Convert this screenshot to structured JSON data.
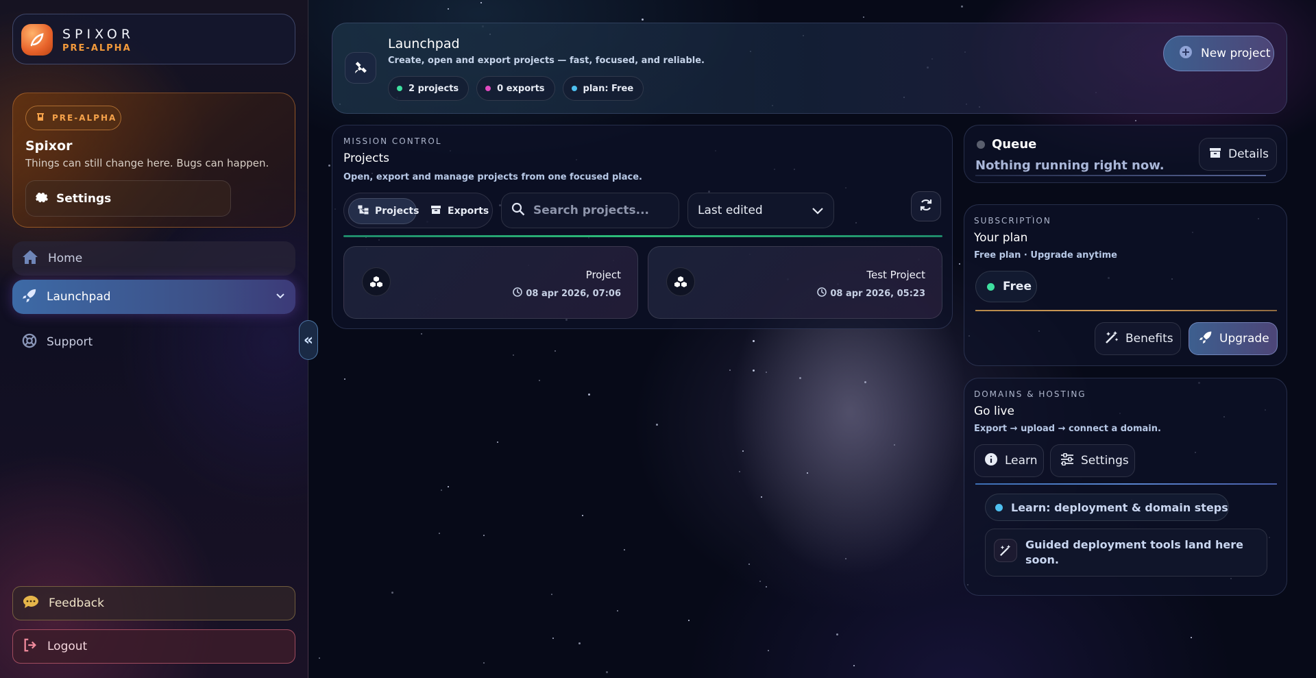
{
  "brand": {
    "name": "SPIXOR",
    "stage": "PRE-ALPHA"
  },
  "notice": {
    "badge": "PRE-ALPHA",
    "title": "Spixor",
    "description": "Things can still change here. Bugs can happen.",
    "settings_label": "Settings"
  },
  "nav": {
    "home": "Home",
    "launchpad": "Launchpad",
    "support": "Support",
    "feedback": "Feedback",
    "logout": "Logout"
  },
  "hero": {
    "title": "Launchpad",
    "description": "Create, open and export projects — fast, focused, and reliable.",
    "pills": [
      {
        "label": "2 projects",
        "color": "#3ee0a0"
      },
      {
        "label": "0 exports",
        "color": "#e04ac0"
      },
      {
        "label": "plan: Free",
        "color": "#4ec0f0"
      }
    ],
    "new_project_label": "New project"
  },
  "mission": {
    "eyebrow": "MISSION CONTROL",
    "title": "Projects",
    "description": "Open, export and manage projects from one focused place.",
    "tabs": {
      "projects": "Projects",
      "exports": "Exports"
    },
    "search_placeholder": "Search projects...",
    "sort_value": "Last edited",
    "projects": [
      {
        "name": "Project",
        "date": "08 apr 2026, 07:06"
      },
      {
        "name": "Test Project",
        "date": "08 apr 2026, 05:23"
      }
    ]
  },
  "queue": {
    "title": "Queue",
    "status": "Nothing running right now.",
    "details_label": "Details"
  },
  "subscription": {
    "eyebrow": "SUBSCRIPTION",
    "title": "Your plan",
    "description": "Free plan · Upgrade anytime",
    "plan": "Free",
    "benefits_label": "Benefits",
    "upgrade_label": "Upgrade"
  },
  "domains": {
    "eyebrow": "DOMAINS & HOSTING",
    "title": "Go live",
    "description": "Export → upload → connect a domain.",
    "learn_label": "Learn",
    "settings_label": "Settings",
    "learn_pill": "Learn: deployment & domain steps",
    "guided": "Guided deployment tools land here soon."
  },
  "colors": {
    "accent": "#3d6aa6",
    "brand_orange": "#f39a3b",
    "success": "#2ec07a"
  }
}
